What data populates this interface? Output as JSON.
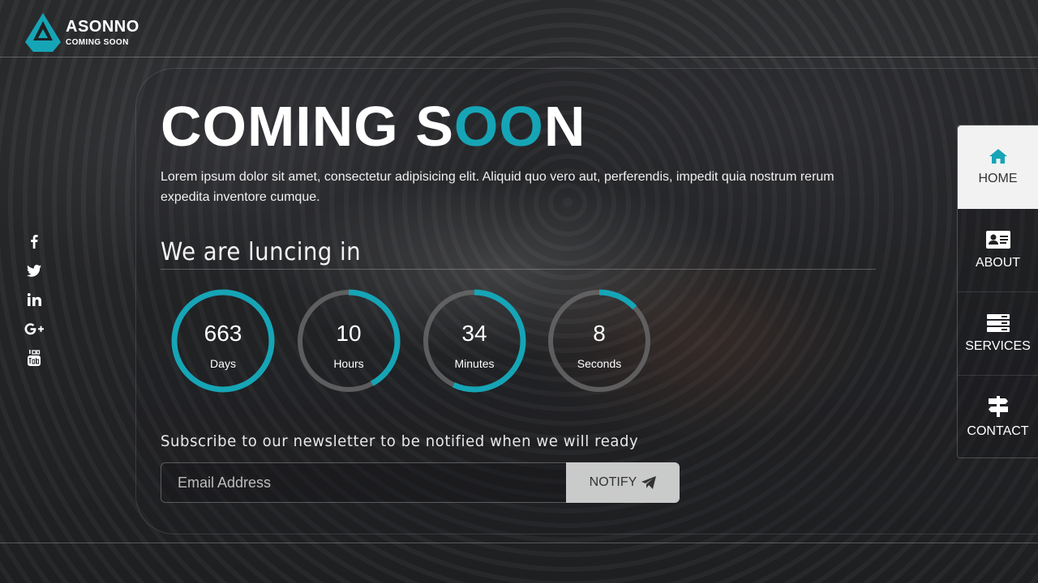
{
  "header": {
    "brand": "ASONNO",
    "brand_sub": "COMING SOON",
    "logo_letter": "A"
  },
  "colors": {
    "accent": "#16a5b6",
    "ring_track": "#6b6b6d"
  },
  "hero": {
    "title_part1": "COMING S",
    "title_accent": "OO",
    "title_part2": "N",
    "description": "Lorem ipsum dolor sit amet, consectetur adipisicing elit. Aliquid quo vero aut, perferendis, impedit quia nostrum rerum expedita inventore cumque.",
    "launch_heading": "We are luncing in"
  },
  "countdown": [
    {
      "value": "663",
      "label": "Days",
      "progress": 1.0
    },
    {
      "value": "10",
      "label": "Hours",
      "progress": 0.42
    },
    {
      "value": "34",
      "label": "Minutes",
      "progress": 0.57
    },
    {
      "value": "8",
      "label": "Seconds",
      "progress": 0.13
    }
  ],
  "newsletter": {
    "heading": "Subscribe to our newsletter to be notified when we will ready",
    "placeholder": "Email Address",
    "button_label": "NOTIFY"
  },
  "social": [
    {
      "name": "facebook-icon",
      "glyph": "f"
    },
    {
      "name": "twitter-icon",
      "glyph": "twitter"
    },
    {
      "name": "linkedin-icon",
      "glyph": "in"
    },
    {
      "name": "google-plus-icon",
      "glyph": "G+"
    },
    {
      "name": "youtube-icon",
      "glyph": "You Tube"
    }
  ],
  "nav": [
    {
      "label": "HOME",
      "icon": "home-icon",
      "active": true
    },
    {
      "label": "ABOUT",
      "icon": "id-card-icon",
      "active": false
    },
    {
      "label": "SERVICES",
      "icon": "server-icon",
      "active": false
    },
    {
      "label": "CONTACT",
      "icon": "signpost-icon",
      "active": false
    }
  ]
}
